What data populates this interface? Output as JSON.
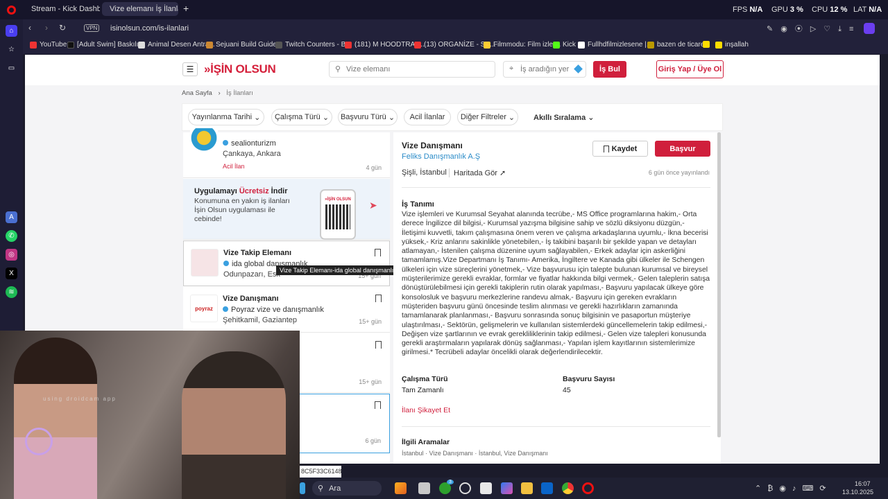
{
  "browser": {
    "tabs": [
      {
        "label": "Stream - Kick Dashboard",
        "color": "#53fc18"
      },
      {
        "label": "Vize elemanı İş İlanları & İ",
        "color": "#d5203b"
      }
    ],
    "new_tab": "+",
    "stats": {
      "fps_label": "FPS",
      "fps": "N/A",
      "gpu_label": "GPU",
      "gpu": "3 %",
      "cpu_label": "CPU",
      "cpu": "12 %",
      "lat_label": "LAT",
      "lat": "N/A"
    },
    "url": "isinolsun.com/is-ilanlari",
    "vpn": "VPN",
    "bookmarks": [
      {
        "label": "YouTube",
        "color": "#e33"
      },
      {
        "label": "[Adult Swim] Baskılı...",
        "color": "#111"
      },
      {
        "label": "Animal Desen Antra...",
        "color": "#ddd"
      },
      {
        "label": "Sejuani Build Guide...",
        "color": "#c83"
      },
      {
        "label": "Twitch Counters - B...",
        "color": "#555"
      },
      {
        "label": "(181) M HOODTRAP...",
        "color": "#e33"
      },
      {
        "label": "(13) ORGANİZE - SA...",
        "color": "#e33"
      },
      {
        "label": "Filmmodu: Film izle,...",
        "color": "#fc3"
      },
      {
        "label": "Kick",
        "color": "#53fc18"
      },
      {
        "label": "Fullhdfilmizlesene |...",
        "color": "#fff"
      },
      {
        "label": "bazen de ticaret",
        "color": "#b90"
      },
      {
        "label": "S",
        "color": "#fd0"
      },
      {
        "label": "inşallah",
        "color": "#fd0"
      }
    ]
  },
  "site": {
    "logo": "»İŞİN OLSUN",
    "search_placeholder": "Vize elemanı",
    "location_placeholder": "İş aradığın yer",
    "search_button": "İş Bul",
    "login_button": "Giriş Yap / Üye Ol",
    "breadcrumb": [
      "Ana Sayfa",
      "İş İlanları"
    ],
    "filters": [
      "Yayınlanma Tarihi",
      "Çalışma Türü",
      "Başvuru Türü",
      "Acil İlanlar",
      "Diğer Filtreler",
      "Akıllı Sıralama"
    ],
    "cards": [
      {
        "company": "sealionturizm",
        "location": "Çankaya, Ankara",
        "tag": "Acil İlan",
        "date": "4 gün"
      },
      {
        "title": "Vize Takip Elemanı",
        "company": "ida global danışmanlık",
        "location": "Odunpazarı, Esk",
        "date": "15+ gün"
      },
      {
        "title": "Vize Danışmanı",
        "company": "Poyraz vize ve danışmanlık",
        "location": "Şehitkamil, Gaziantep",
        "date": "15+ gün"
      },
      {
        "date": "15+ gün"
      },
      {
        "date": "6 gün"
      }
    ],
    "promo": {
      "prefix": "Uygulamayı ",
      "highlight": "Ücretsiz",
      "suffix": " İndir",
      "text": "Konumuna en yakın iş ilanları İşin Olsun uygulaması ile cebinde!",
      "phone_logo": "»İŞİN OLSUN"
    },
    "tooltip": "Vize Takip Elemanı-ida global danışmanlık",
    "poyraz_logo": "poyraz",
    "detail": {
      "title": "Vize Danışmanı",
      "company": "Feliks Danışmanlık A.Ş",
      "location": "Şişli, İstanbul",
      "map_link": "Haritada Gör",
      "posted": "6 gün önce yayınlandı",
      "save": "Kaydet",
      "apply": "Başvur",
      "section": "İş Tanımı",
      "description": "Vize işlemleri ve Kurumsal Seyahat alanında tecrübe,- MS Office programlarına hakim,- Orta derece İngilizce dil bilgisi,- Kurumsal yazışma bilgisine sahip ve sözlü diksiyonu düzgün,- İletişimi kuvvetli, takım çalışmasına önem veren ve çalışma arkadaşlarına uyumlu,- İkna becerisi yüksek,- Kriz anlarını sakinlikle yönetebilen,- İş takibini başarılı bir şekilde yapan ve detayları atlamayan,- İstenilen çalışma düzenine uyum sağlayabilen,- Erkek adaylar için askerliğini tamamlamış.Vize Departmanı İş Tanımı- Amerika, İngiltere ve Kanada gibi ülkeler ile Schengen ülkeleri için vize süreçlerini yönetmek,- Vize başvurusu için talepte bulunan kurumsal ve bireysel müşterilerimize gerekli evraklar, formlar ve fiyatlar hakkında bilgi vermek,- Gelen taleplerin satışa dönüştürülebilmesi için gerekli takiplerin rutin olarak yapılması,- Başvuru yapılacak ülkeye göre konsolosluk ve başvuru merkezlerine randevu almak,- Başvuru için gereken evrakların müşteriden başvuru günü öncesinde teslim alınması ve gerekli hazırlıkların zamanında tamamlanarak planlanması,- Başvuru sonrasında sonuç bilgisinin ve pasaportun müşteriye ulaştırılması,- Sektörün, gelişmelerin ve kullanılan sistemlerdeki güncellemelerin takip edilmesi,- Değişen vize şartlarının ve evrak gerekliliklerinin takip edilmesi,- Gelen vize talepleri konusunda gerekli araştırmaların yapılarak dönüş sağlanması,- Yapılan işlem kayıtlarının sistemlerimize girilmesi.* Tecrübeli adaylar öncelikli olarak değerlendirilecektir.",
      "work_type_label": "Çalışma Türü",
      "work_type": "Tam Zamanlı",
      "applications_label": "Başvuru Sayısı",
      "applications": "45",
      "report": "İlanı Şikayet Et",
      "related_title": "İlgili Aramalar",
      "related": [
        "İstanbul",
        "Vize Danışmanı",
        "İstanbul, Vize Danışmanı"
      ]
    }
  },
  "overlay": {
    "cam_text": "using droidcam app",
    "hash": "8C5F33C6148"
  },
  "taskbar": {
    "search": "Ara",
    "time": "16:07",
    "date": "13.10.2025",
    "badge": "3"
  }
}
